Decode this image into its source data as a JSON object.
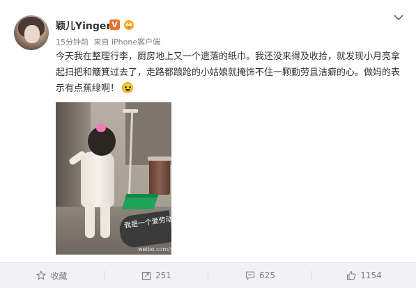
{
  "post": {
    "author": {
      "name": "颖儿Yinger",
      "verified_badge": "V",
      "verified_color": "#e8712c",
      "badge_icon": "crown-icon"
    },
    "meta": {
      "time": "15分钟前",
      "source": "来自 iPhone客户端"
    },
    "text": "今天我在整理行李，厨房地上又一个遗落的纸巾。我还没来得及收拾，就发现小月亮拿起扫把和簸箕过去了，走路都踉跄的小姑娘就掩饰不住一颗勤劳且洁癖的心。做妈的表示有点蕉绿啊！",
    "emoji": "laughing-crying-emoji",
    "image": {
      "sticker_text": "我是一个爱劳动的美少女!",
      "watermark": "weibo.com/yinger"
    }
  },
  "actions": {
    "favorite": {
      "label": "收藏",
      "icon": "star-icon"
    },
    "repost": {
      "label": "251",
      "icon": "repost-icon"
    },
    "comment": {
      "label": "625",
      "icon": "comment-icon"
    },
    "like": {
      "label": "1154",
      "icon": "thumbs-up-icon"
    }
  },
  "colors": {
    "accent": "#e8712c",
    "action_bar_bg": "#f2f2f5",
    "text": "#333333",
    "muted": "#808080"
  }
}
